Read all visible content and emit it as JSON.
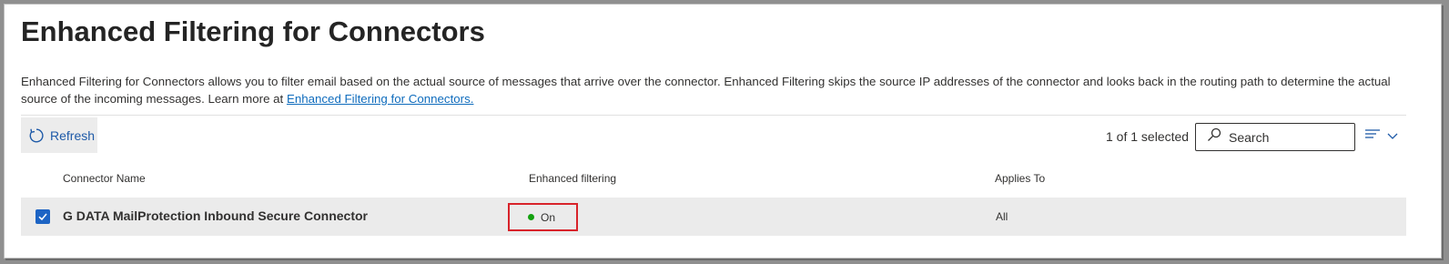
{
  "page": {
    "title": "Enhanced Filtering for Connectors",
    "description": "Enhanced Filtering for Connectors allows you to filter email based on the actual source of messages that arrive over the connector. Enhanced Filtering skips the source IP addresses of the connector and looks back in the routing path to determine the actual source of the incoming messages. Learn more at ",
    "learn_more_link": "Enhanced Filtering for Connectors."
  },
  "toolbar": {
    "refresh_label": "Refresh",
    "selection_count": "1 of 1 selected",
    "search_placeholder": "Search",
    "refresh_icon": "refresh-icon",
    "search_icon": "search-icon",
    "filter_icon": "filter-lines-icon",
    "chevron_icon": "chevron-down-icon"
  },
  "table": {
    "columns": [
      "Connector Name",
      "Enhanced filtering",
      "Applies To"
    ],
    "rows": [
      {
        "selected": true,
        "connector_name": "G DATA MailProtection Inbound Secure Connector",
        "enhanced_filtering": "On",
        "applies_to": "All"
      }
    ]
  },
  "colors": {
    "accent": "#1d64c4",
    "link": "#0f6cbd",
    "status_on": "#13a10e",
    "highlight_box": "#d8232a",
    "selected_row": "#ebebeb"
  }
}
